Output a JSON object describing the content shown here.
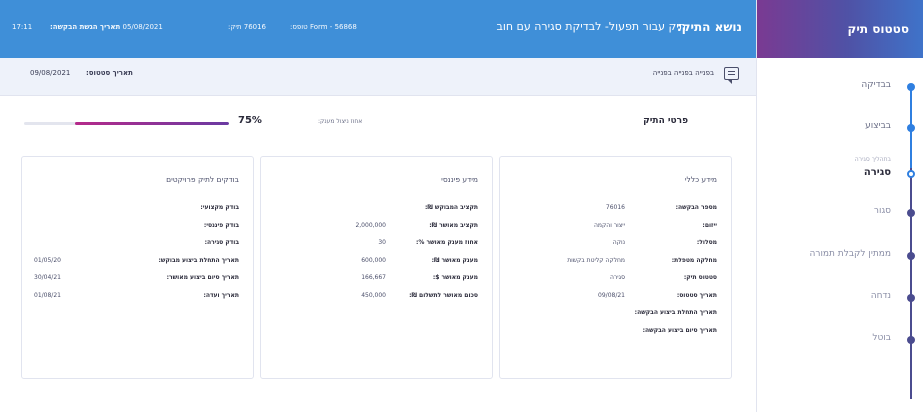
{
  "sidebar": {
    "title": "סטטוס תיק",
    "steps": [
      {
        "label": "בבדיקה",
        "state": "done"
      },
      {
        "label": "בביצוע",
        "state": "done"
      },
      {
        "label": "סגירה",
        "sublabel": "בתהליך סגירה",
        "state": "current"
      },
      {
        "label": "סגור",
        "state": "pending"
      },
      {
        "label": "ממתין לקבלת תמורה",
        "state": "pending"
      },
      {
        "label": "נדחה",
        "state": "pending"
      },
      {
        "label": "בוטל",
        "state": "pending"
      }
    ]
  },
  "topbar": {
    "subject_label": "נושא התיק:",
    "subject_value": "תיק עבור תפעול- לבדיקת סגירה עם חוב",
    "form_label": "טופס:",
    "form_value": "Form - 56868",
    "case_label": "תיק:",
    "case_value": "76016",
    "request_date_label": "תאריך הגשת הבקשה:",
    "request_date_value": "05/08/2021",
    "time_value": "17:11"
  },
  "subbar": {
    "message_text": "בפנייה בפנייה בפנייה",
    "status_date_label": "תאריך סטטוס:",
    "status_date_value": "09/08/2021"
  },
  "main": {
    "section_title": "פרטי התיק",
    "progress_label": "אחוז ניצול מענק:",
    "progress_value": "75%",
    "progress_fraction": 0.75
  },
  "cards": {
    "general": {
      "title": "מידע כללי",
      "rows": [
        {
          "label": "מספר הבקשה:",
          "value": "76016"
        },
        {
          "label": "ייזום:",
          "value": "ייצור והקמה"
        },
        {
          "label": "מסלול:",
          "value": "נוקה"
        },
        {
          "label": "מחלקה מטפלת:",
          "value": "מחלקה קליטת בקשות"
        },
        {
          "label": "סטטוס תיק:",
          "value": "סגירה"
        },
        {
          "label": "תאריך סטטוס:",
          "value": "09/08/21"
        },
        {
          "label": "תאריך התחלת ביצוע הבקשה:",
          "value": ""
        },
        {
          "label": "תאריך סיום ביצוע הבקשה:",
          "value": ""
        }
      ]
    },
    "financial": {
      "title": "מידע פיננסי",
      "rows": [
        {
          "label": "תקציב המבוקש ₪:",
          "value": ""
        },
        {
          "label": "תקציב מאושר ₪:",
          "value": "2,000,000"
        },
        {
          "label": "אחוז מענק מאושר %:",
          "value": "30"
        },
        {
          "label": "מענק מאושר ₪:",
          "value": "600,000"
        },
        {
          "label": "מענק מאושר $:",
          "value": "166,667"
        },
        {
          "label": "סכום מאושר לתשלום ₪:",
          "value": "450,000"
        }
      ]
    },
    "reports": {
      "title": "בודקים לתיק פרויקטים",
      "rows": [
        {
          "label": "בודק מקצועי:",
          "value": ""
        },
        {
          "label": "בודק פיננסי:",
          "value": ""
        },
        {
          "label": "בודק סגירה:",
          "value": ""
        },
        {
          "label": "תאריך התחלת ביצוע מבוקש:",
          "value": "01/05/20"
        },
        {
          "label": "תאריך סיום ביצוע מאושר:",
          "value": "30/04/21"
        },
        {
          "label": "תאריך ועדה:",
          "value": "01/08/21"
        }
      ]
    }
  }
}
